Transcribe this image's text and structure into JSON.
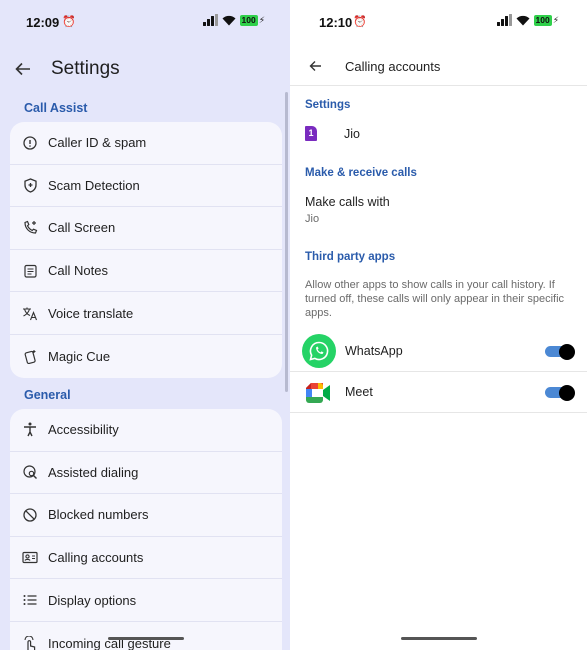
{
  "left": {
    "status": {
      "time": "12:09",
      "battery": "100"
    },
    "title": "Settings",
    "sections": [
      {
        "label": "Call Assist",
        "items": [
          {
            "label": "Caller ID & spam",
            "icon": "info-circle-icon"
          },
          {
            "label": "Scam Detection",
            "icon": "shield-icon"
          },
          {
            "label": "Call Screen",
            "icon": "phone-sparkle-icon"
          },
          {
            "label": "Call Notes",
            "icon": "notes-icon"
          },
          {
            "label": "Voice translate",
            "icon": "translate-icon"
          },
          {
            "label": "Magic Cue",
            "icon": "magic-cue-icon"
          }
        ]
      },
      {
        "label": "General",
        "items": [
          {
            "label": "Accessibility",
            "icon": "accessibility-icon"
          },
          {
            "label": "Assisted dialing",
            "icon": "globe-search-icon"
          },
          {
            "label": "Blocked numbers",
            "icon": "blocked-icon"
          },
          {
            "label": "Calling accounts",
            "icon": "contact-card-icon"
          },
          {
            "label": "Display options",
            "icon": "list-icon"
          },
          {
            "label": "Incoming call gesture",
            "icon": "gesture-icon"
          }
        ]
      }
    ]
  },
  "right": {
    "status": {
      "time": "12:10",
      "battery": "100"
    },
    "title": "Calling accounts",
    "settings_section": "Settings",
    "sim_badge": "1",
    "sim_name": "Jio",
    "make_receive_section": "Make & receive calls",
    "make_calls_with": "Make calls with",
    "make_calls_value": "Jio",
    "third_party_section": "Third party apps",
    "third_party_desc": "Allow other apps to show calls in your call history. If turned off, these calls will only appear in their specific apps.",
    "apps": [
      {
        "label": "WhatsApp",
        "enabled": true,
        "icon": "whatsapp-icon"
      },
      {
        "label": "Meet",
        "enabled": true,
        "icon": "google-meet-icon"
      }
    ]
  },
  "colors": {
    "accent": "#2a5bab",
    "toggle_track": "#4b88d4",
    "left_bg": "#e4e6fa",
    "battery": "#2fd04a"
  }
}
